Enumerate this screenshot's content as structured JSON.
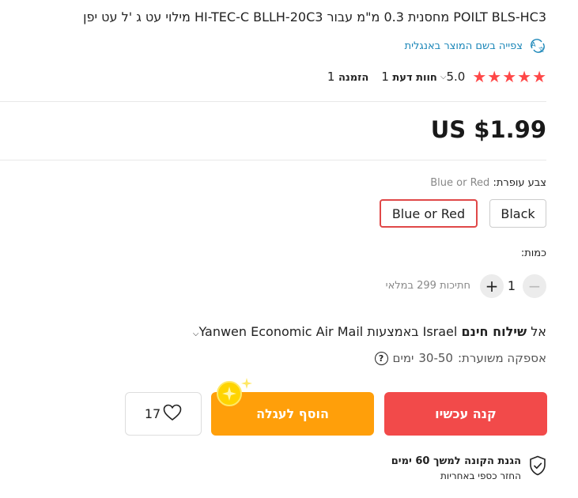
{
  "product": {
    "title": "POILT BLS-HC3 מחסנית 0.3 מ\"מ עבור HI-TEC-C BLLH-20C3 מילוי עט ג 'ל עט יפן",
    "translate_label": "צפייה בשם המוצר באנגלית",
    "rating": {
      "score": "5.0",
      "stars": 5,
      "reviews_count": "1",
      "reviews_label": "חוות דעת",
      "orders_count": "1",
      "orders_label": "הזמנה"
    },
    "price": "US $1.99"
  },
  "color": {
    "label": "צבע עופרת:",
    "selected": "Blue or Red",
    "options": [
      "Black",
      "Blue or Red"
    ]
  },
  "quantity": {
    "label": "כמות:",
    "value": "1",
    "minus": "−",
    "plus": "+",
    "available": "חתיכות 299 במלאי"
  },
  "shipping": {
    "free": "שילוח חינם",
    "to": "אל",
    "country": "Israel",
    "via": "באמצעות",
    "carrier": "Yanwen Economic Air Mail",
    "delivery_label": "אספקה משוערת:",
    "delivery_days": "30-50",
    "delivery_unit": "ימים"
  },
  "actions": {
    "buy_now": "קנה עכשיו",
    "add_to_cart": "הוסף לעגלה",
    "wishlist_count": "17"
  },
  "protection": {
    "title": "הגנת הקונה למשך 60 ימים",
    "subtitle": "החזר כספי באחריות"
  },
  "colors": {
    "accent_red": "#f24a4a",
    "cart_orange": "#ff9f0a",
    "star_red": "#ff4747",
    "link_blue": "#1a86b8"
  }
}
